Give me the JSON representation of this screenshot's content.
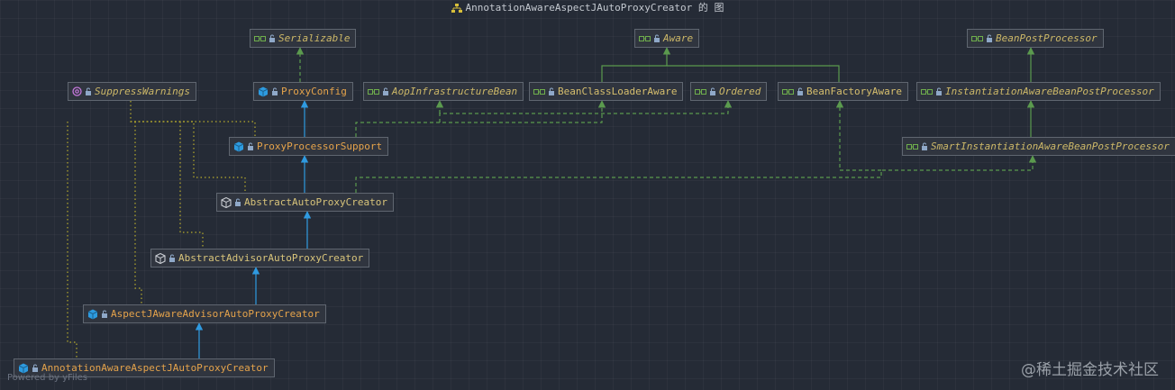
{
  "title": "AnnotationAwareAspectJAutoProxyCreator 的 图",
  "footer": "Powered by yFiles",
  "watermark": "@稀土掘金技术社区",
  "colors": {
    "background": "#252b36",
    "node_fill": "#30353f",
    "node_border": "#5f6670",
    "interface_edge": "#5b9a4e",
    "extends_edge": "#2f9ae0",
    "annotation_edge": "#b7ab2c"
  },
  "nodes": {
    "serializable": {
      "label": "Serializable",
      "kind": "interface"
    },
    "aware": {
      "label": "Aware",
      "kind": "interface"
    },
    "bean_post_processor": {
      "label": "BeanPostProcessor",
      "kind": "interface"
    },
    "suppress_warnings": {
      "label": "SuppressWarnings",
      "kind": "annotation"
    },
    "proxy_config": {
      "label": "ProxyConfig",
      "kind": "class"
    },
    "aop_infrastructure_bean": {
      "label": "AopInfrastructureBean",
      "kind": "interface"
    },
    "bean_class_loader_aware": {
      "label": "BeanClassLoaderAware",
      "kind": "interface"
    },
    "ordered": {
      "label": "Ordered",
      "kind": "interface"
    },
    "bean_factory_aware": {
      "label": "BeanFactoryAware",
      "kind": "interface"
    },
    "instantiation_aware_bpp": {
      "label": "InstantiationAwareBeanPostProcessor",
      "kind": "interface"
    },
    "proxy_processor_support": {
      "label": "ProxyProcessorSupport",
      "kind": "class"
    },
    "smart_instantiation_aware_bpp": {
      "label": "SmartInstantiationAwareBeanPostProcessor",
      "kind": "interface"
    },
    "abstract_auto_proxy_creator": {
      "label": "AbstractAutoProxyCreator",
      "kind": "abstract"
    },
    "abstract_advisor_auto_proxy_creator": {
      "label": "AbstractAdvisorAutoProxyCreator",
      "kind": "abstract"
    },
    "aspectj_aware_advisor_auto_proxy_creator": {
      "label": "AspectJAwareAdvisorAutoProxyCreator",
      "kind": "class"
    },
    "annotation_aware_aspectj_auto_proxy_creator": {
      "label": "AnnotationAwareAspectJAutoProxyCreator",
      "kind": "class"
    }
  }
}
